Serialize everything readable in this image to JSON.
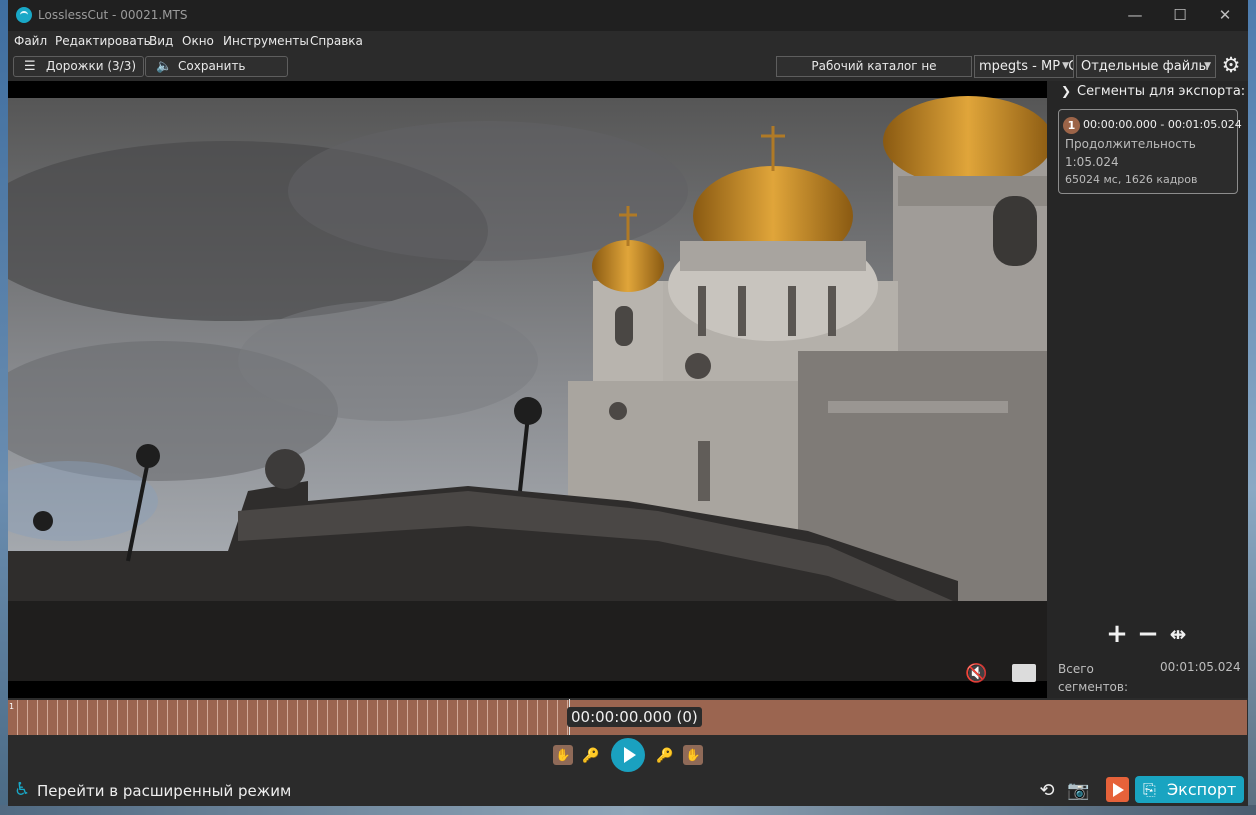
{
  "window": {
    "title": "LosslessCut - 00021.MTS",
    "controls": [
      "—",
      "☐",
      "✕"
    ]
  },
  "menu": [
    "Файл",
    "Редактировать",
    "Вид",
    "Окно",
    "Инструменты",
    "Справка"
  ],
  "toolbar": {
    "tracks_label": "Дорожки (3/3)",
    "save_audio_label": "Сохранить аудио",
    "working_dir_label": "Рабочий каталог не установлен",
    "format_value": "mpegts - MPEG-TS",
    "mode_value": "Отдельные файлы"
  },
  "segments_panel": {
    "header": "Сегменты для экспорта:",
    "segments": [
      {
        "number": "1",
        "range": "00:00:00.000 - 00:01:05.024",
        "duration_label": "Продолжительность",
        "duration": "1:05.024",
        "detail": "65024 мс, 1626 кадров"
      }
    ],
    "tools": [
      "+",
      "−",
      "⇹"
    ],
    "total_label": "Всего сегментов:",
    "total_value": "00:01:05.024"
  },
  "timeline": {
    "start_marker": "1",
    "current_time": "00:00:00.000 (0)",
    "playhead_fraction": 0.0
  },
  "bottom": {
    "advanced_mode_label": "Перейти в расширенный режим",
    "export_label": "Экспорт"
  },
  "colors": {
    "accent": "#19a4c1",
    "segment": "#9b6550",
    "segment_button": "#e6623a"
  }
}
